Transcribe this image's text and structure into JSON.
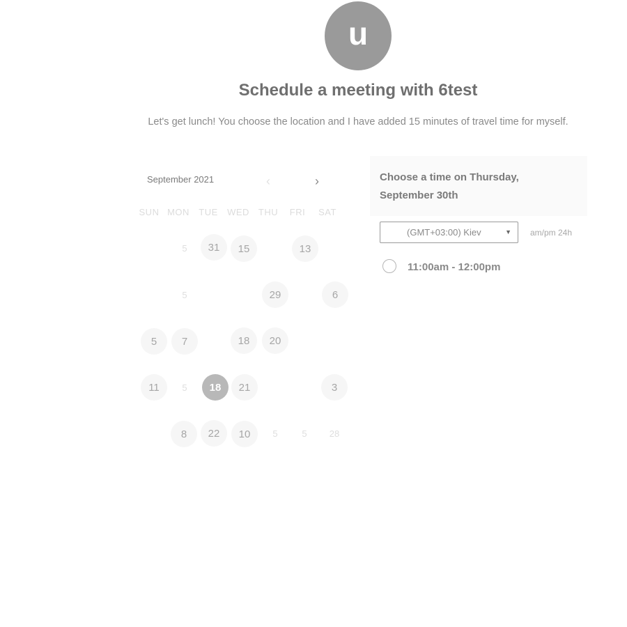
{
  "avatar": {
    "initial": "u"
  },
  "header": {
    "title": "Schedule a meeting with 6test",
    "description": "Let's get lunch! You choose the location and I have added 15 minutes of travel time for myself."
  },
  "calendar": {
    "month_label": "September 2021",
    "prev_icon": "‹",
    "next_icon": "›",
    "weekdays": [
      "SUN",
      "MON",
      "TUE",
      "WED",
      "THU",
      "FRI",
      "SAT"
    ],
    "rows": [
      [
        "",
        "5",
        "31",
        "15",
        "",
        "13",
        ""
      ],
      [
        "",
        "5",
        "",
        "",
        "29",
        "",
        "6"
      ],
      [
        "5",
        "7",
        "",
        "18",
        "20",
        "",
        ""
      ],
      [
        "11",
        "5",
        "18",
        "21",
        "",
        "",
        "3"
      ],
      [
        "",
        "8",
        "22",
        "10",
        "5",
        "5",
        "28"
      ]
    ],
    "selected_day": "18"
  },
  "time_panel": {
    "heading": "Choose a time on Thursday, September 30th",
    "timezone": "(GMT+03:00) Kiev",
    "format_options": "am/pm  24h",
    "slots": [
      {
        "label": "11:00am - 12:00pm"
      }
    ]
  },
  "colors": {
    "avatar_bg": "#9a9a9a",
    "selected_day_bg": "#b8b8b8",
    "available_day_bg": "#f6f6f6"
  }
}
